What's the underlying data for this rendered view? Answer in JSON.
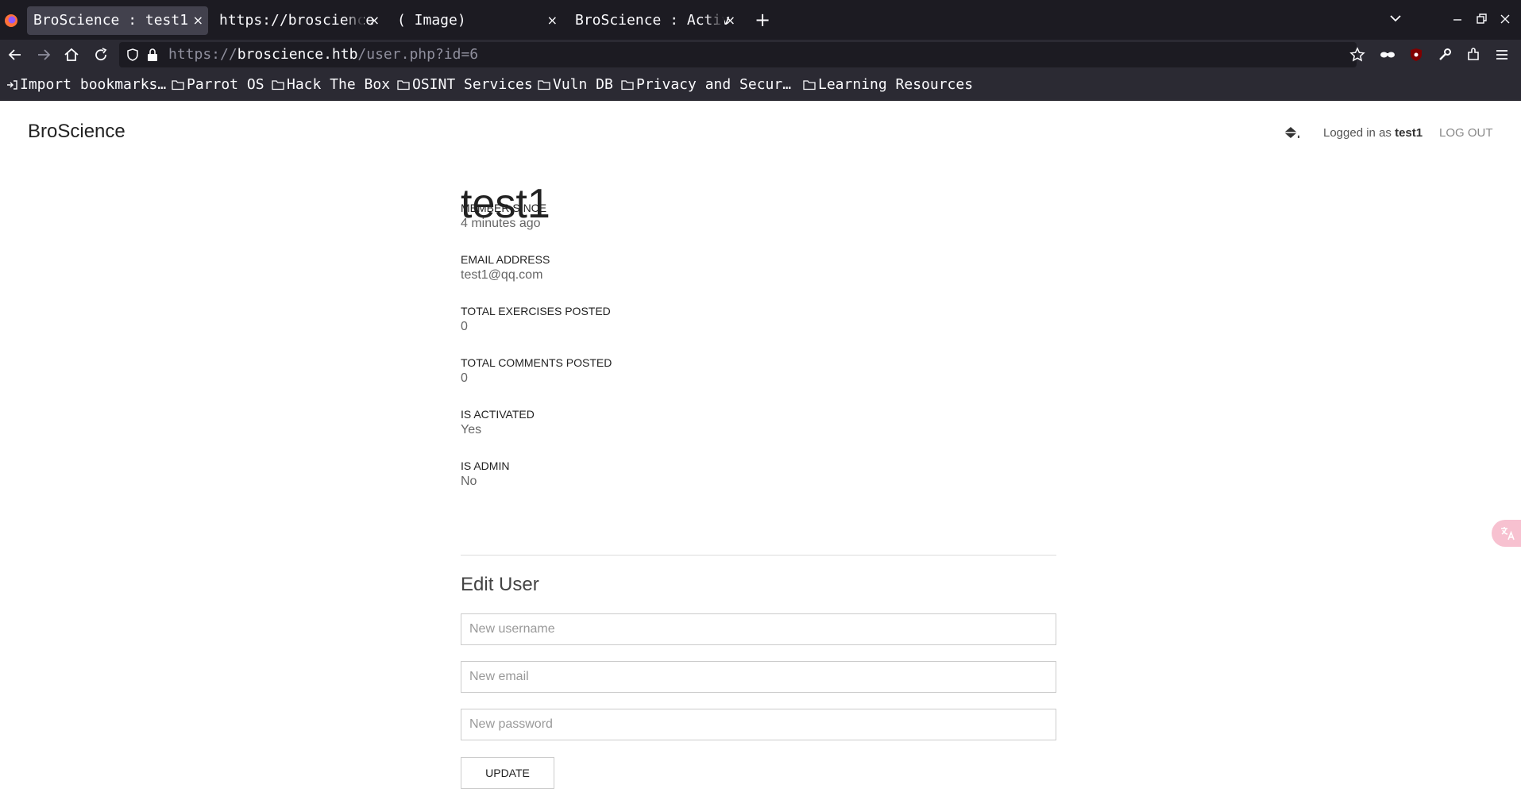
{
  "browser": {
    "tabs": [
      {
        "label": "BroScience : test1",
        "active": true
      },
      {
        "label": "https://broscience",
        "active": false
      },
      {
        "label": "( Image)",
        "active": false
      },
      {
        "label": "BroScience : Activ",
        "active": false
      }
    ],
    "close_glyph": "×",
    "new_tab_glyph": "+",
    "url": {
      "scheme": "https://",
      "host": "broscience.htb",
      "path": "/user.php?id=6"
    },
    "bookmarks": [
      "Import bookmarks…",
      "Parrot OS",
      "Hack The Box",
      "OSINT Services",
      "Vuln DB",
      "Privacy and Secur…",
      "Learning Resources"
    ]
  },
  "site": {
    "brand": "BroScience",
    "logged_in_prefix": "Logged in as",
    "logged_in_user": "test1",
    "logout_label": "LOG OUT"
  },
  "profile": {
    "username": "test1",
    "fields": [
      {
        "label": "MEMBER SINCE",
        "value": "4 minutes ago"
      },
      {
        "label": "EMAIL ADDRESS",
        "value": "test1@qq.com"
      },
      {
        "label": "TOTAL EXERCISES POSTED",
        "value": "0"
      },
      {
        "label": "TOTAL COMMENTS POSTED",
        "value": "0"
      },
      {
        "label": "IS ACTIVATED",
        "value": "Yes"
      },
      {
        "label": "IS ADMIN",
        "value": "No"
      }
    ]
  },
  "edit_form": {
    "title": "Edit User",
    "username_placeholder": "New username",
    "email_placeholder": "New email",
    "password_placeholder": "New password",
    "submit_label": "UPDATE"
  },
  "colors": {
    "chrome_dark": "#1c1b22",
    "chrome_toolbar": "#2b2a33",
    "active_tab": "#42414d",
    "translate_widget": "#f7c1d0"
  },
  "icons": [
    "firefox-logo-icon",
    "back-arrow-icon",
    "forward-arrow-icon",
    "home-icon",
    "reload-icon",
    "shield-icon",
    "lock-icon",
    "star-icon",
    "mask-icon",
    "ublock-icon",
    "wrench-icon",
    "extensions-icon",
    "menu-icon",
    "paint-bucket-icon",
    "folder-icon",
    "translate-icon"
  ]
}
